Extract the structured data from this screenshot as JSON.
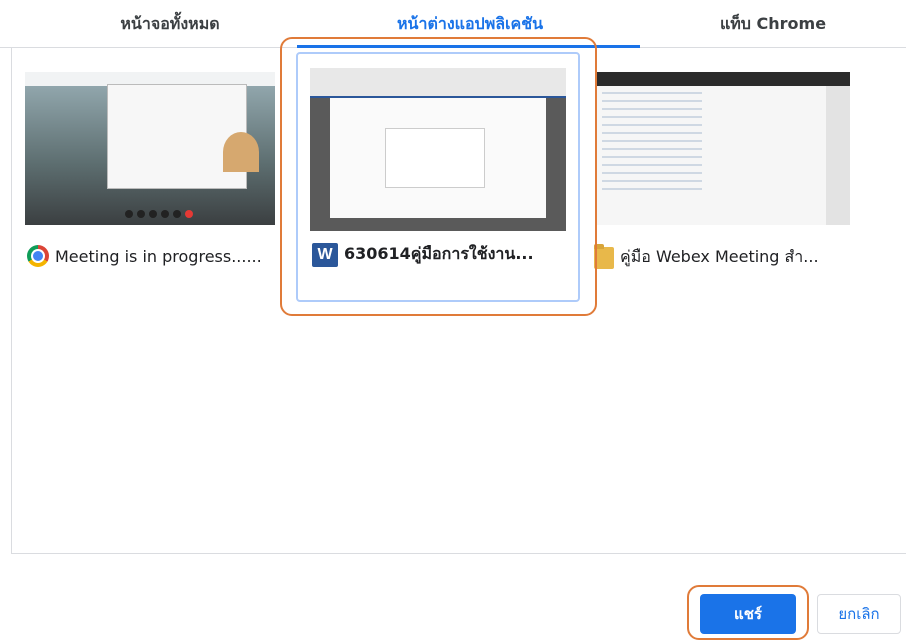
{
  "tabs": [
    {
      "label": "หน้าจอทั้งหมด"
    },
    {
      "label": "หน้าต่างแอปพลิเคชัน"
    },
    {
      "label": "แท็บ Chrome"
    }
  ],
  "cards": [
    {
      "caption": "Meeting is in progress......",
      "icon": "chrome-icon"
    },
    {
      "caption": "630614คู่มือการใช้งาน...",
      "icon": "word-icon",
      "icon_text": "W"
    },
    {
      "caption": "คู่มือ Webex Meeting สำ...",
      "icon": "folder-icon"
    }
  ],
  "buttons": {
    "share": "แชร์",
    "cancel": "ยกเลิก"
  },
  "colors": {
    "accent": "#1a73e8",
    "highlight": "#e07b39"
  }
}
